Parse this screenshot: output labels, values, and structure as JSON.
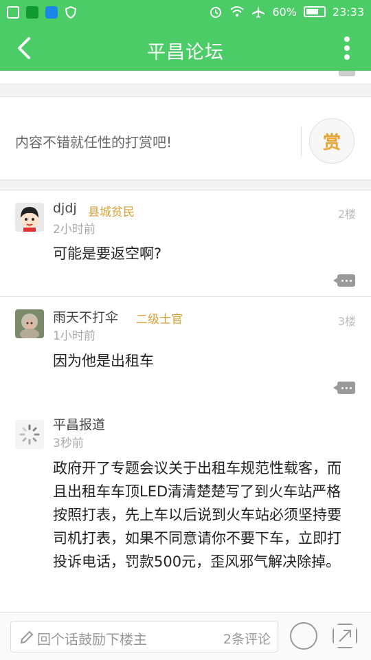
{
  "status_bar": {
    "battery": "60%",
    "time": "23:33"
  },
  "header": {
    "title": "平昌论坛"
  },
  "reward": {
    "text": "内容不错就任性的打赏吧!",
    "button": "赏"
  },
  "comments": [
    {
      "name": "djdj",
      "rank": "县城贫民",
      "time": "2小时前",
      "floor": "2楼",
      "content": "可能是要返空啊?"
    },
    {
      "name": "雨天不打伞",
      "rank": "二级士官",
      "time": "1小时前",
      "floor": "3楼",
      "content": "因为他是出租车"
    },
    {
      "name": "平昌报道",
      "time": "3秒前",
      "content": "政府开了专题会议关于出租车规范性载客，而且出租车车顶LED清清楚楚写了到火车站严格按照打表，先上车以后说到火车站必须坚持要司机打表，如果不同意请你不要下车，立即打投诉电话，罚款500元，歪风邪气解决除掉。"
    }
  ],
  "bottom_bar": {
    "placeholder": "回个话鼓励下楼主",
    "comment_count": "2条评论"
  },
  "colors": {
    "brand_green": "#4ccc66",
    "rank_gold": "#d9a139"
  }
}
